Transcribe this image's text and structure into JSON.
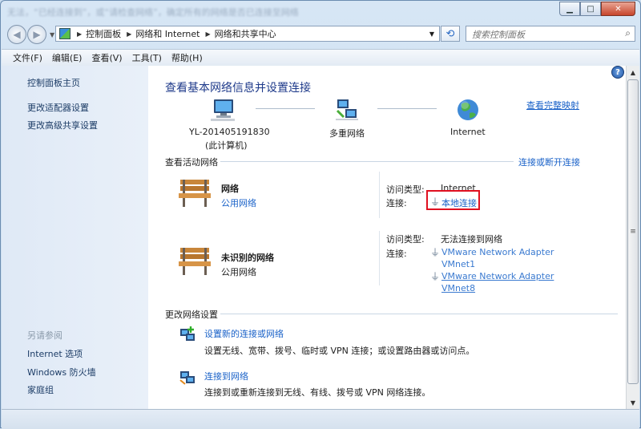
{
  "window": {
    "blurred_title": "无法，“已经连接到”，或“请检查网络”，确定所有的网络是否已连接至网络"
  },
  "address_bar": {
    "crumbs": [
      "控制面板",
      "网络和 Internet",
      "网络和共享中心"
    ]
  },
  "search": {
    "placeholder": "搜索控制面板"
  },
  "menu": [
    "文件(F)",
    "编辑(E)",
    "查看(V)",
    "工具(T)",
    "帮助(H)"
  ],
  "sidebar": {
    "top_links": [
      "控制面板主页",
      "更改适配器设置",
      "更改高级共享设置"
    ],
    "see_also_label": "另请参阅",
    "bottom_links": [
      "Internet 选项",
      "Windows 防火墙",
      "家庭组"
    ]
  },
  "main": {
    "title": "查看基本网络信息并设置连接",
    "map_link": "查看完整映射",
    "nodes": {
      "computer_name": "YL-201405191830",
      "computer_sub": "(此计算机)",
      "network": "多重网络",
      "internet": "Internet"
    },
    "active_section": "查看活动网络",
    "connect_link": "连接或断开连接",
    "networks": [
      {
        "name": "网络",
        "type": "公用网络",
        "access_label": "访问类型:",
        "access_value": "Internet",
        "conn_label": "连接:",
        "conns": [
          "本地连接"
        ]
      },
      {
        "name": "未识别的网络",
        "type": "公用网络",
        "access_label": "访问类型:",
        "access_value": "无法连接到网络",
        "conn_label": "连接:",
        "conns": [
          "VMware Network Adapter",
          "VMnet1",
          "VMware Network Adapter",
          "VMnet8"
        ]
      }
    ],
    "change_section": "更改网络设置",
    "tasks": [
      {
        "title": "设置新的连接或网络",
        "desc": "设置无线、宽带、拨号、临时或 VPN 连接；或设置路由器或访问点。"
      },
      {
        "title": "连接到网络",
        "desc": "连接到或重新连接到无线、有线、拨号或 VPN 网络连接。"
      }
    ]
  },
  "colors": {
    "link": "#1a62c8",
    "title": "#1e3a8a",
    "highlight_box": "#e01020",
    "sidebar_bg": "#dfe9f6"
  }
}
